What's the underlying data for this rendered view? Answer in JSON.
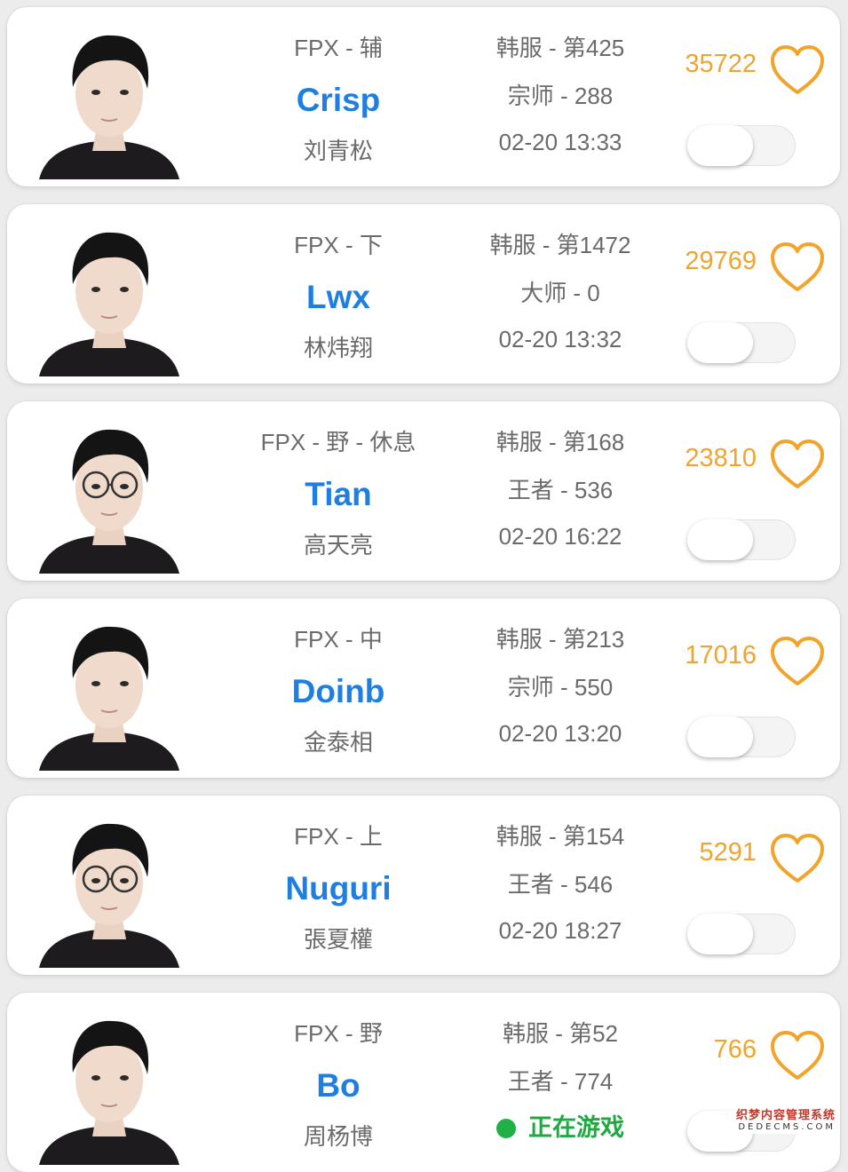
{
  "players": [
    {
      "team_role": "FPX - 辅",
      "ign": "Crisp",
      "real_name": "刘青松",
      "server_rank": "韩服 - 第425",
      "tier": "宗师 - 288",
      "last_seen": "02-20 13:33",
      "likes": "35722",
      "toggle_on": false,
      "glasses": false
    },
    {
      "team_role": "FPX - 下",
      "ign": "Lwx",
      "real_name": "林炜翔",
      "server_rank": "韩服 - 第1472",
      "tier": "大师 - 0",
      "last_seen": "02-20 13:32",
      "likes": "29769",
      "toggle_on": false,
      "glasses": false
    },
    {
      "team_role": "FPX - 野 - 休息",
      "ign": "Tian",
      "real_name": "高天亮",
      "server_rank": "韩服 - 第168",
      "tier": "王者 - 536",
      "last_seen": "02-20 16:22",
      "likes": "23810",
      "toggle_on": false,
      "glasses": true
    },
    {
      "team_role": "FPX - 中",
      "ign": "Doinb",
      "real_name": "金泰相",
      "server_rank": "韩服 - 第213",
      "tier": "宗师 - 550",
      "last_seen": "02-20 13:20",
      "likes": "17016",
      "toggle_on": false,
      "glasses": false
    },
    {
      "team_role": "FPX - 上",
      "ign": "Nuguri",
      "real_name": "張夏權",
      "server_rank": "韩服 - 第154",
      "tier": "王者 - 546",
      "last_seen": "02-20 18:27",
      "likes": "5291",
      "toggle_on": false,
      "glasses": true
    },
    {
      "team_role": "FPX - 野",
      "ign": "Bo",
      "real_name": "周杨博",
      "server_rank": "韩服 - 第52",
      "tier": "王者 - 774",
      "status": "正在游戏",
      "likes": "766",
      "toggle_on": false,
      "glasses": false
    }
  ],
  "colors": {
    "accent": "#1e7fe0",
    "likes": "#f2a42a",
    "online": "#1fb146",
    "text_secondary": "#6b6b6b"
  },
  "watermark": {
    "line1": "织梦内容管理系统",
    "line2": "DEDECMS.COM"
  }
}
